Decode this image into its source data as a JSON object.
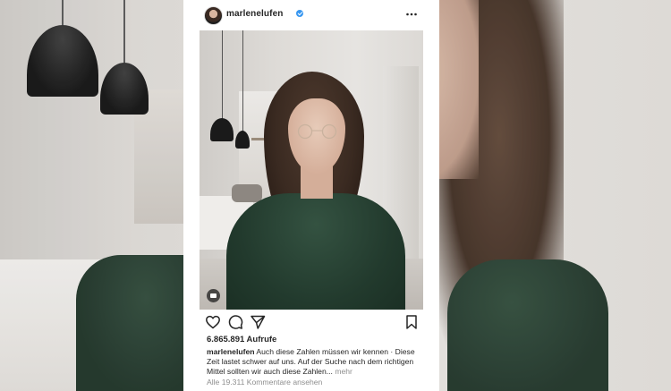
{
  "post": {
    "username": "marlenelufen",
    "views": "6.865.891 Aufrufe",
    "caption_user": "marlenelufen",
    "caption_text": "Auch diese Zahlen müssen wir kennen · Diese Zeit lastet schwer auf uns. Auf der Suche nach dem richtigen Mittel sollten wir auch diese Zahlen...",
    "more_label": "mehr",
    "comments_link": "Alle 19.311 Kommentare ansehen"
  },
  "icons": {
    "verified": "verified-badge-icon",
    "more": "more-options-icon",
    "like": "heart-icon",
    "comment": "comment-icon",
    "share": "paper-plane-icon",
    "save": "bookmark-icon",
    "camera": "camera-icon"
  },
  "colors": {
    "verified_blue": "#3897f0",
    "text_primary": "#262626",
    "text_secondary": "#8e8e8e"
  }
}
